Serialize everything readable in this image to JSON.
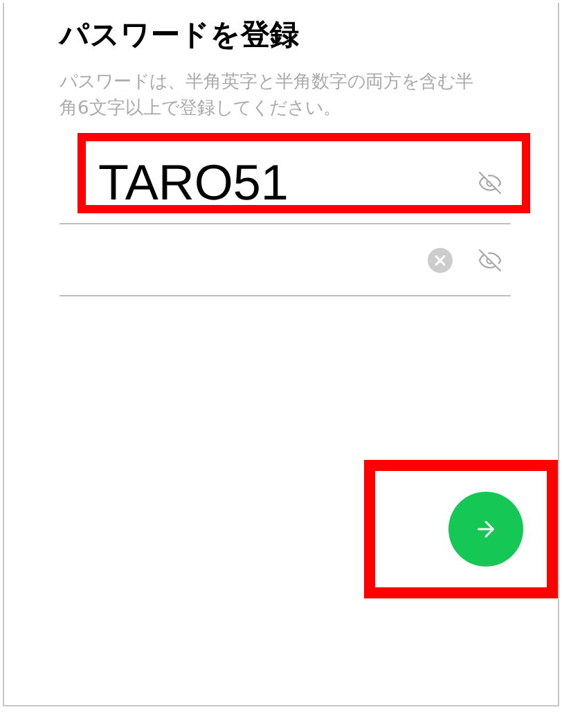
{
  "title": "パスワードを登録",
  "description": "パスワードは、半角英字と半角数字の両方を含む半角6文字以上で登録してください。",
  "fields": [
    {
      "value": "TARO51",
      "clear_visible": false,
      "highlighted": true
    },
    {
      "clear_visible": true,
      "highlighted": false
    }
  ],
  "next_button": {
    "highlighted": true
  }
}
